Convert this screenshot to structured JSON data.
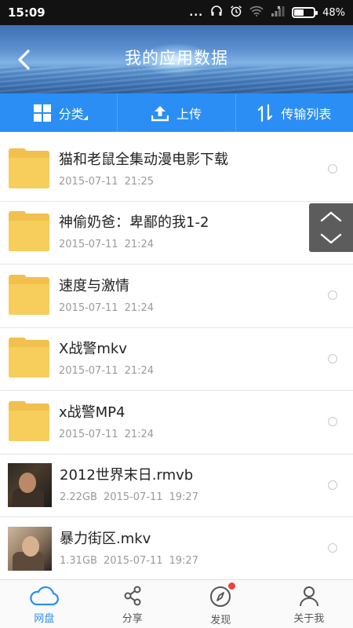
{
  "status_bar": {
    "time": "15:09",
    "dots": "...",
    "battery_percent": "48%",
    "battery_level": 0.48,
    "icons": [
      "headphones-icon",
      "alarm-icon",
      "wifi-icon",
      "signal-icon",
      "battery-icon"
    ]
  },
  "header": {
    "title": "我的应用数据",
    "back_icon": "back-arrow-icon"
  },
  "toolbar": {
    "category_label": "分类",
    "upload_label": "上传",
    "transfer_label": "传输列表",
    "accent": "#2a8ef5"
  },
  "files": [
    {
      "type": "folder",
      "name": "猫和老鼠全集动漫电影下载",
      "size": "",
      "date": "2015-07-11",
      "time": "21:25"
    },
    {
      "type": "folder",
      "name": "神偷奶爸：卑鄙的我1-2",
      "size": "",
      "date": "2015-07-11",
      "time": "21:24"
    },
    {
      "type": "folder",
      "name": "速度与激情",
      "size": "",
      "date": "2015-07-11",
      "time": "21:24"
    },
    {
      "type": "folder",
      "name": "X战警mkv",
      "size": "",
      "date": "2015-07-11",
      "time": "21:24"
    },
    {
      "type": "folder",
      "name": "x战警MP4",
      "size": "",
      "date": "2015-07-11",
      "time": "21:24"
    },
    {
      "type": "video",
      "name": "2012世界末日.rmvb",
      "size": "2.22GB",
      "date": "2015-07-11",
      "time": "19:27"
    },
    {
      "type": "video",
      "name": "暴力街区.mkv",
      "size": "1.31GB",
      "date": "2015-07-11",
      "time": "19:27"
    }
  ],
  "bottom_nav": {
    "items": [
      {
        "label": "网盘",
        "icon": "cloud-icon",
        "active": true
      },
      {
        "label": "分享",
        "icon": "share-icon",
        "active": false
      },
      {
        "label": "发现",
        "icon": "compass-icon",
        "active": false
      },
      {
        "label": "关于我",
        "icon": "person-icon",
        "active": false
      }
    ]
  }
}
